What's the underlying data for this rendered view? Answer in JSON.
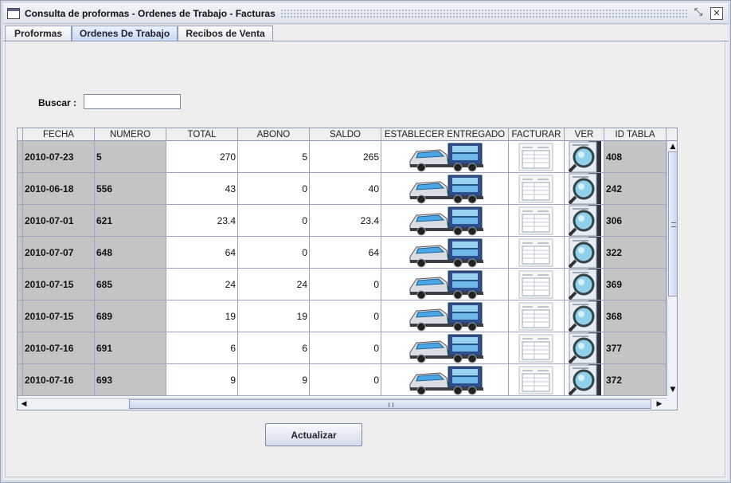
{
  "window": {
    "title": "Consulta de proformas - Ordenes de Trabajo - Facturas",
    "restore_glyph": "⤡",
    "close_glyph": "✕"
  },
  "tabs": [
    {
      "label": "Proformas",
      "active": false
    },
    {
      "label": "Ordenes De Trabajo",
      "active": true
    },
    {
      "label": "Recibos de Venta",
      "active": false
    }
  ],
  "search": {
    "label": "Buscar :",
    "value": ""
  },
  "table": {
    "columns": [
      "FECHA",
      "NUMERO",
      "TOTAL",
      "ABONO",
      "SALDO",
      "ESTABLECER  ENTREGADO",
      "FACTURAR",
      "VER",
      "ID TABLA"
    ],
    "rows": [
      {
        "fecha": "2010-07-23",
        "numero": "5",
        "total": "270",
        "abono": "5",
        "saldo": "265",
        "id": "408"
      },
      {
        "fecha": "2010-06-18",
        "numero": "556",
        "total": "43",
        "abono": "0",
        "saldo": "40",
        "id": "242"
      },
      {
        "fecha": "2010-07-01",
        "numero": "621",
        "total": "23.4",
        "abono": "0",
        "saldo": "23.4",
        "id": "306"
      },
      {
        "fecha": "2010-07-07",
        "numero": "648",
        "total": "64",
        "abono": "0",
        "saldo": "64",
        "id": "322"
      },
      {
        "fecha": "2010-07-15",
        "numero": "685",
        "total": "24",
        "abono": "24",
        "saldo": "0",
        "id": "369"
      },
      {
        "fecha": "2010-07-15",
        "numero": "689",
        "total": "19",
        "abono": "19",
        "saldo": "0",
        "id": "368"
      },
      {
        "fecha": "2010-07-16",
        "numero": "691",
        "total": "6",
        "abono": "6",
        "saldo": "0",
        "id": "377"
      },
      {
        "fecha": "2010-07-16",
        "numero": "693",
        "total": "9",
        "abono": "9",
        "saldo": "0",
        "id": "372"
      }
    ],
    "icons": {
      "entregado": "truck-icon",
      "facturar": "invoice-form-icon",
      "ver": "magnifier-icon"
    }
  },
  "scroll": {
    "up": "▲",
    "down": "▼",
    "left": "◀",
    "right": "▶"
  },
  "actions": {
    "refresh_label": "Actualizar"
  },
  "colors": {
    "key_column_bg": "#c4c4c4",
    "active_tab": "#c6d8f1",
    "grid": "#9aa6bd"
  }
}
